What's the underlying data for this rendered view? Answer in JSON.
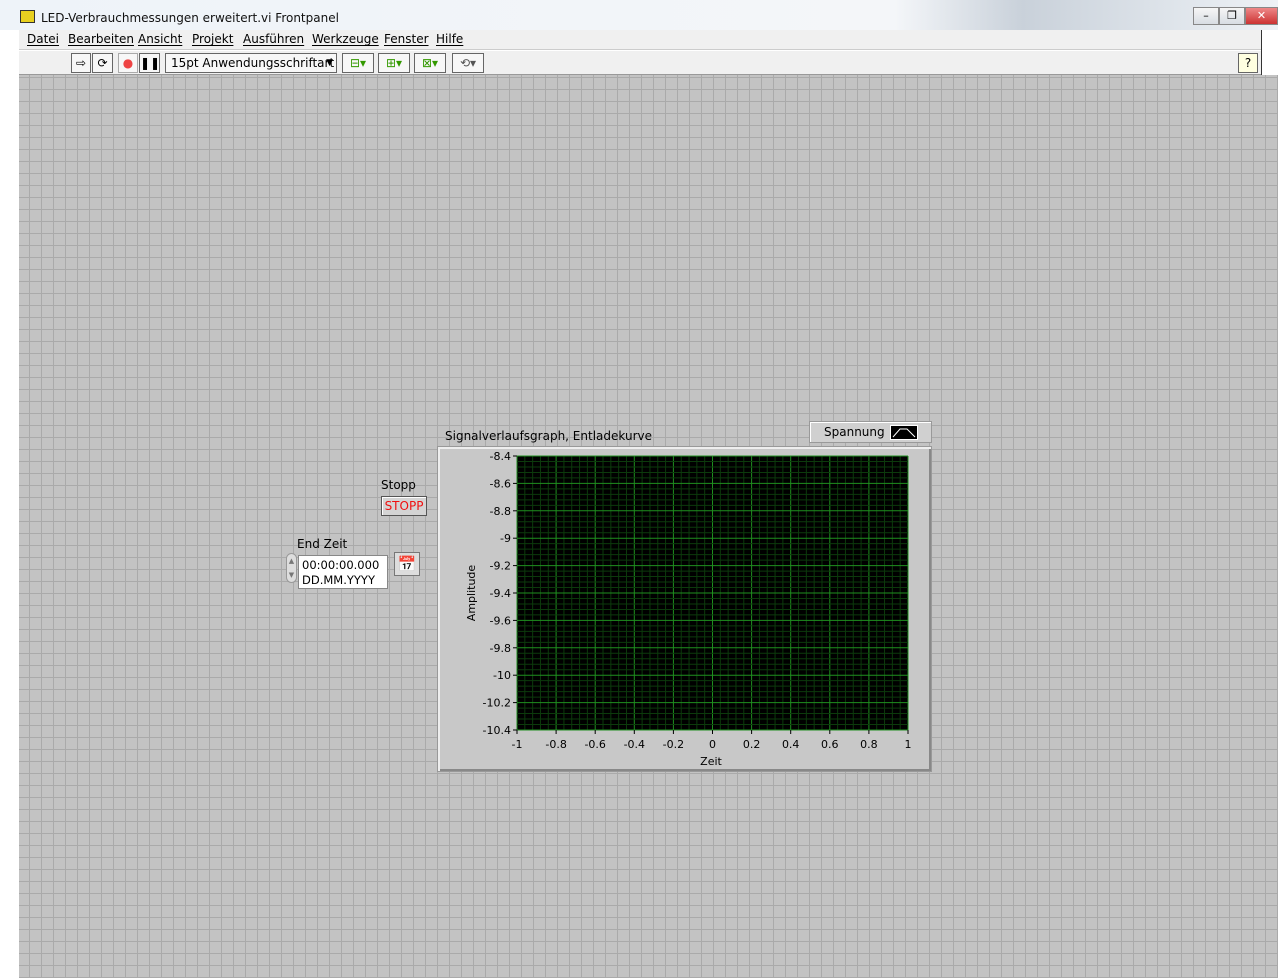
{
  "window": {
    "title": "LED-Verbrauchmessungen erweitert.vi Frontpanel"
  },
  "menu": [
    "Datei",
    "Bearbeiten",
    "Ansicht",
    "Projekt",
    "Ausführen",
    "Werkzeuge",
    "Fenster",
    "Hilfe"
  ],
  "toolbar": {
    "font_select": "15pt Anwendungsschriftart",
    "help": "?"
  },
  "controls": {
    "stop_label": "Stopp",
    "stop_button": "STOPP",
    "end_time_label": "End Zeit",
    "end_time_value": "00:00:00.000",
    "end_date_value": "DD.MM.YYYY"
  },
  "graph": {
    "title": "Signalverlaufsgraph, Entladekurve",
    "legend": "Spannung",
    "xlabel": "Zeit",
    "ylabel": "Amplitude",
    "xticks": [
      "-1",
      "-0.8",
      "-0.6",
      "-0.4",
      "-0.2",
      "0",
      "0.2",
      "0.4",
      "0.6",
      "0.8",
      "1"
    ],
    "yticks": [
      "-8.4",
      "-8.6",
      "-8.8",
      "-9",
      "-9.2",
      "-9.4",
      "-9.6",
      "-9.8",
      "-10",
      "-10.2",
      "-10.4"
    ],
    "colors": {
      "plot_bg": "#000000",
      "grid_major": "#1f8f1f",
      "grid_minor": "#0c3a0c"
    }
  }
}
